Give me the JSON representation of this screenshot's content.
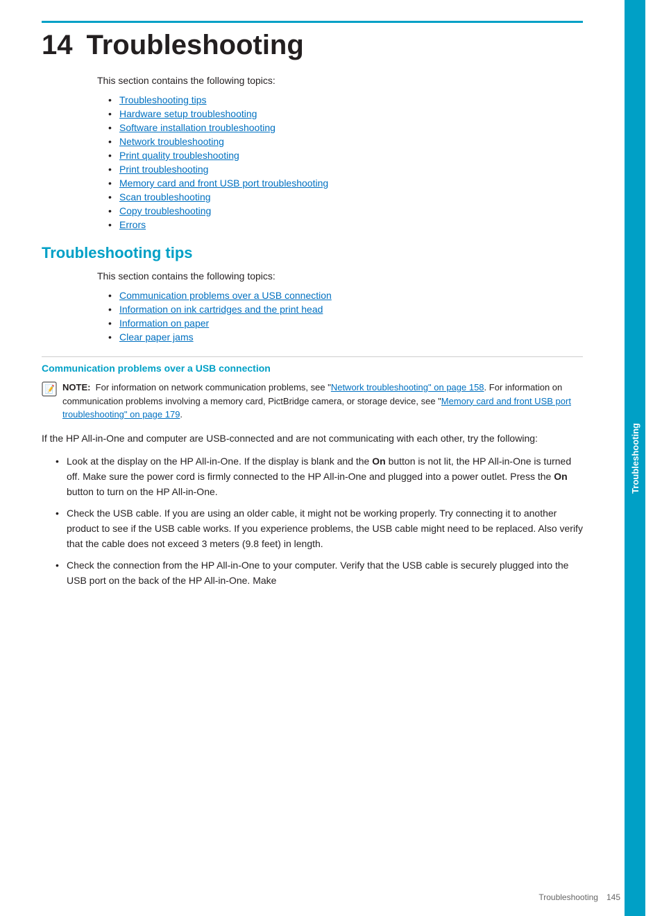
{
  "chapter": {
    "number": "14",
    "title": "Troubleshooting",
    "intro": "This section contains the following topics:",
    "topics": [
      {
        "label": "Troubleshooting tips",
        "href": "#tips"
      },
      {
        "label": "Hardware setup troubleshooting",
        "href": "#hw"
      },
      {
        "label": "Software installation troubleshooting",
        "href": "#sw"
      },
      {
        "label": "Network troubleshooting",
        "href": "#net"
      },
      {
        "label": "Print quality troubleshooting",
        "href": "#pq"
      },
      {
        "label": "Print troubleshooting",
        "href": "#pt"
      },
      {
        "label": "Memory card and front USB port troubleshooting",
        "href": "#mc"
      },
      {
        "label": "Scan troubleshooting",
        "href": "#scan"
      },
      {
        "label": "Copy troubleshooting",
        "href": "#copy"
      },
      {
        "label": "Errors",
        "href": "#errors"
      }
    ]
  },
  "section_tips": {
    "title": "Troubleshooting tips",
    "intro": "This section contains the following topics:",
    "topics": [
      {
        "label": "Communication problems over a USB connection",
        "href": "#usb"
      },
      {
        "label": "Information on ink cartridges and the print head",
        "href": "#ink"
      },
      {
        "label": "Information on paper",
        "href": "#paper"
      },
      {
        "label": "Clear paper jams",
        "href": "#jams"
      }
    ]
  },
  "section_usb": {
    "title": "Communication problems over a USB connection",
    "note_label": "NOTE:",
    "note_text": "For information on network communication problems, see “Network troubleshooting” on page 158. For information on communication problems involving a memory card, PictBridge camera, or storage device, see “Memory card and front USB port troubleshooting” on page 179.",
    "note_link1_text": "Network troubleshooting” on page 158",
    "note_link2_text": "Memory card and front USB port troubleshooting” on page 179",
    "body_intro": "If the HP All-in-One and computer are USB-connected and are not communicating with each other, try the following:",
    "bullets": [
      "Look at the display on the HP All-in-One. If the display is blank and the On button is not lit, the HP All-in-One is turned off. Make sure the power cord is firmly connected to the HP All-in-One and plugged into a power outlet. Press the On button to turn on the HP All-in-One.",
      "Check the USB cable. If you are using an older cable, it might not be working properly. Try connecting it to another product to see if the USB cable works. If you experience problems, the USB cable might need to be replaced. Also verify that the cable does not exceed 3 meters (9.8 feet) in length.",
      "Check the connection from the HP All-in-One to your computer. Verify that the USB cable is securely plugged into the USB port on the back of the HP All-in-One. Make"
    ],
    "bold_words": [
      "On",
      "On"
    ]
  },
  "sidebar": {
    "label": "Troubleshooting"
  },
  "footer": {
    "section": "Troubleshooting",
    "page": "145"
  }
}
